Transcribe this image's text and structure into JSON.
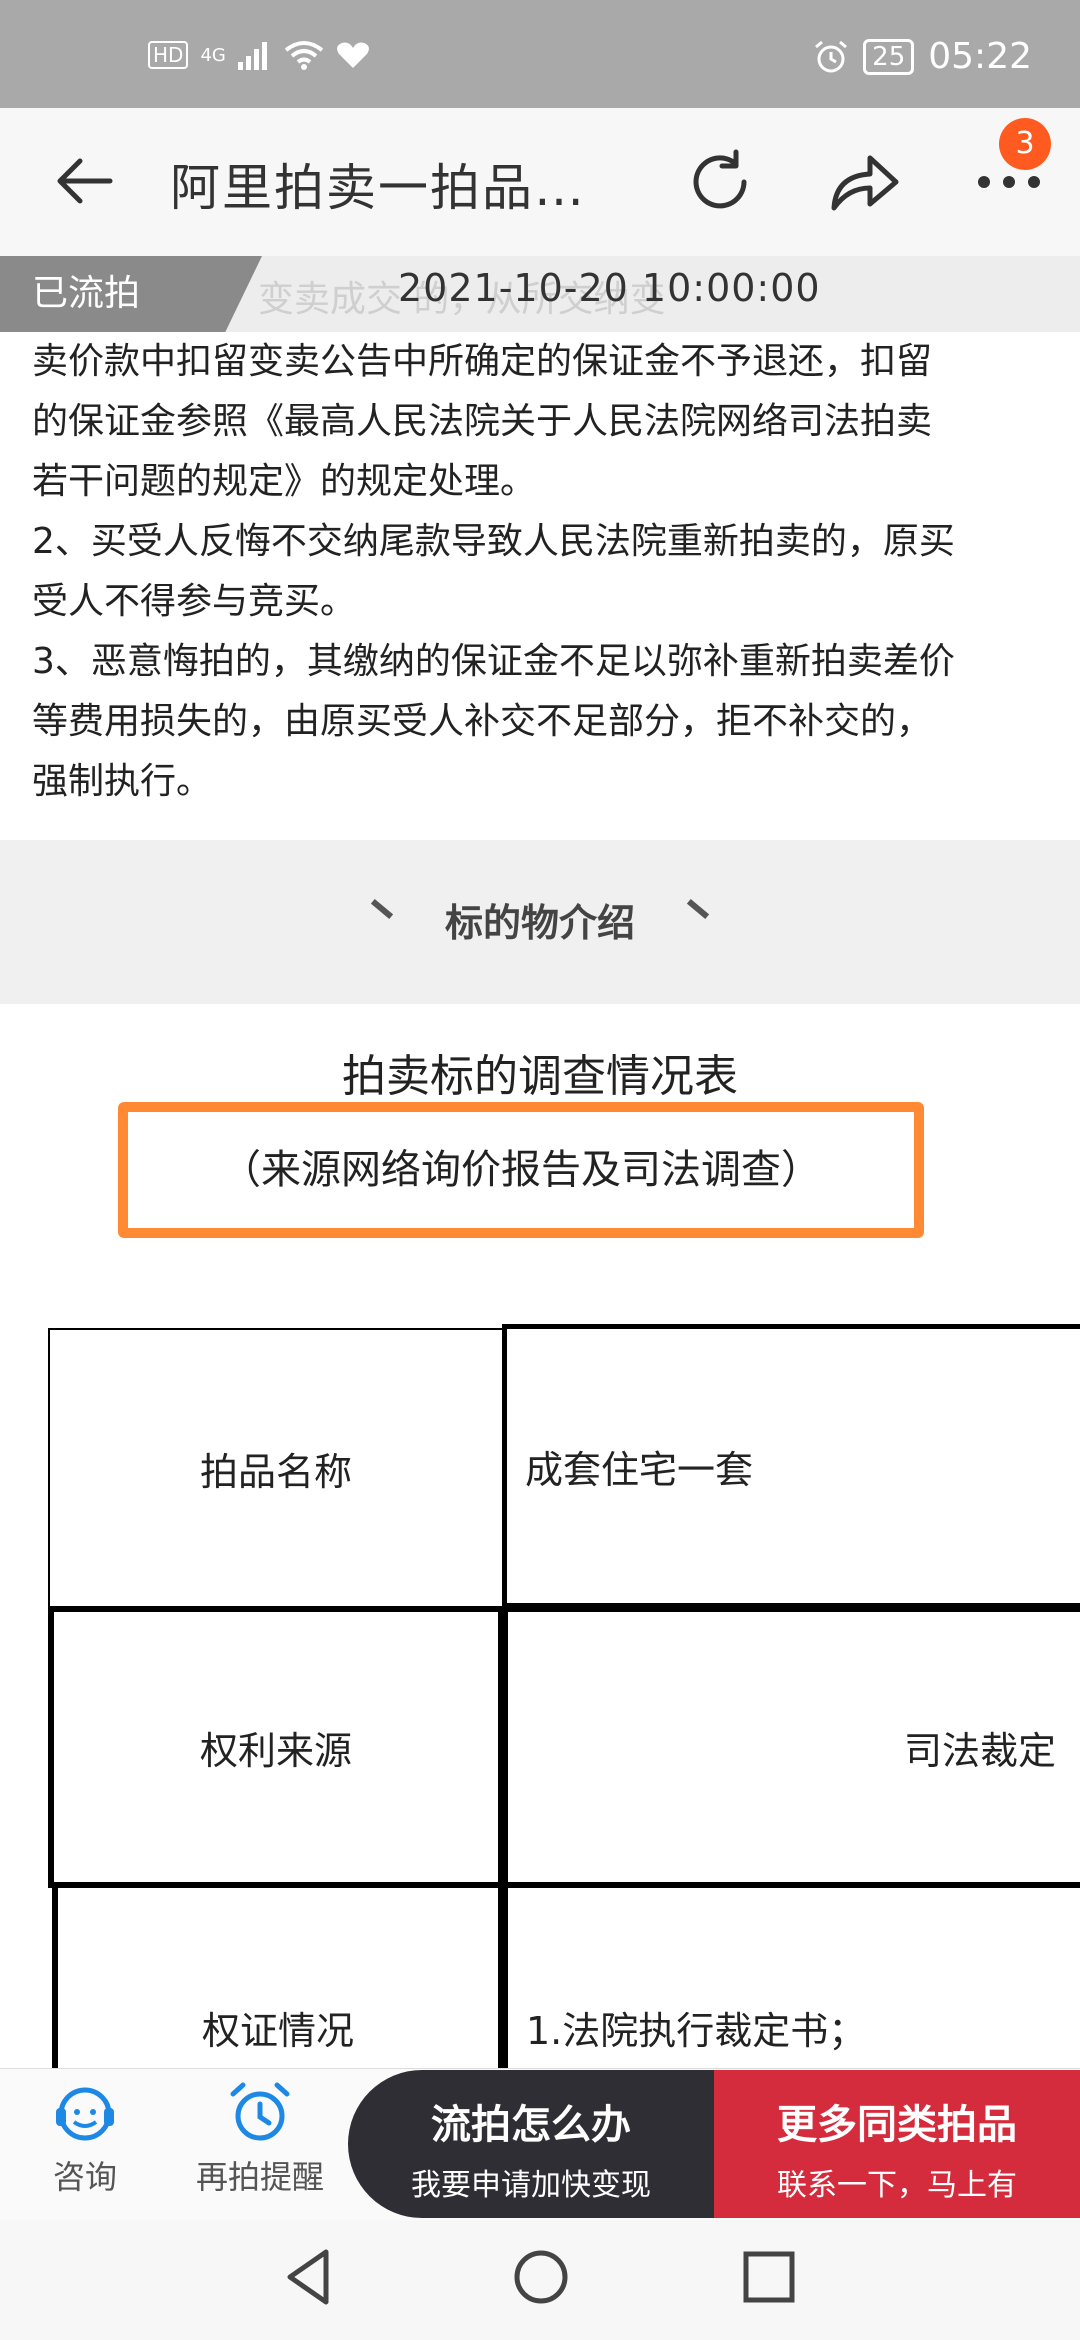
{
  "status_bar": {
    "network_badge": "HD",
    "signal_type": "4G",
    "battery_level": "25",
    "time": "05:22"
  },
  "app_bar": {
    "title": "阿里拍卖一拍品…",
    "notification_count": "3"
  },
  "auction_status": {
    "tag": "已流拍",
    "faded_text": "变卖成交        的，从所交纳变",
    "time": "2021-10-20 10:00:00"
  },
  "rules": [
    "卖价款中扣留变卖公告中所确定的保证金不予退还，扣留",
    "的保证金参照《最高人民法院关于人民法院网络司法拍卖",
    "若干问题的规定》的规定处理。",
    "2、买受人反悔不交纳尾款导致人民法院重新拍卖的，原买",
    "受人不得参与竞买。",
    "3、恶意悔拍的，其缴纳的保证金不足以弥补重新拍卖差价",
    "等费用损失的，由原买受人补交不足部分，拒不补交的，",
    "强制执行。"
  ],
  "section": {
    "heading": "标的物介绍"
  },
  "document": {
    "title": "拍卖标的调查情况表",
    "subtitle": "（来源网络询价报告及司法调查）",
    "highlight_color": "#ff8a33"
  },
  "table": {
    "rows": [
      {
        "label": "拍品名称",
        "value": "成套住宅一套"
      },
      {
        "label": "权利来源",
        "value": "司法裁定"
      },
      {
        "label": "权证情况",
        "value": "1.法院执行裁定书；"
      }
    ]
  },
  "bottom_bar": {
    "consult_label": "咨询",
    "remind_label": "再拍提醒",
    "dark_button": {
      "main": "流拍怎么办",
      "sub": "我要申请加快变现"
    },
    "red_button": {
      "main": "更多同类拍品",
      "sub": "联系一下，马上有"
    }
  },
  "colors": {
    "accent_orange": "#ff8a33",
    "badge": "#ff5a1f",
    "cta_red": "#d42c3c",
    "cta_dark": "#2e2e34",
    "icon_blue": "#1e88e5"
  }
}
